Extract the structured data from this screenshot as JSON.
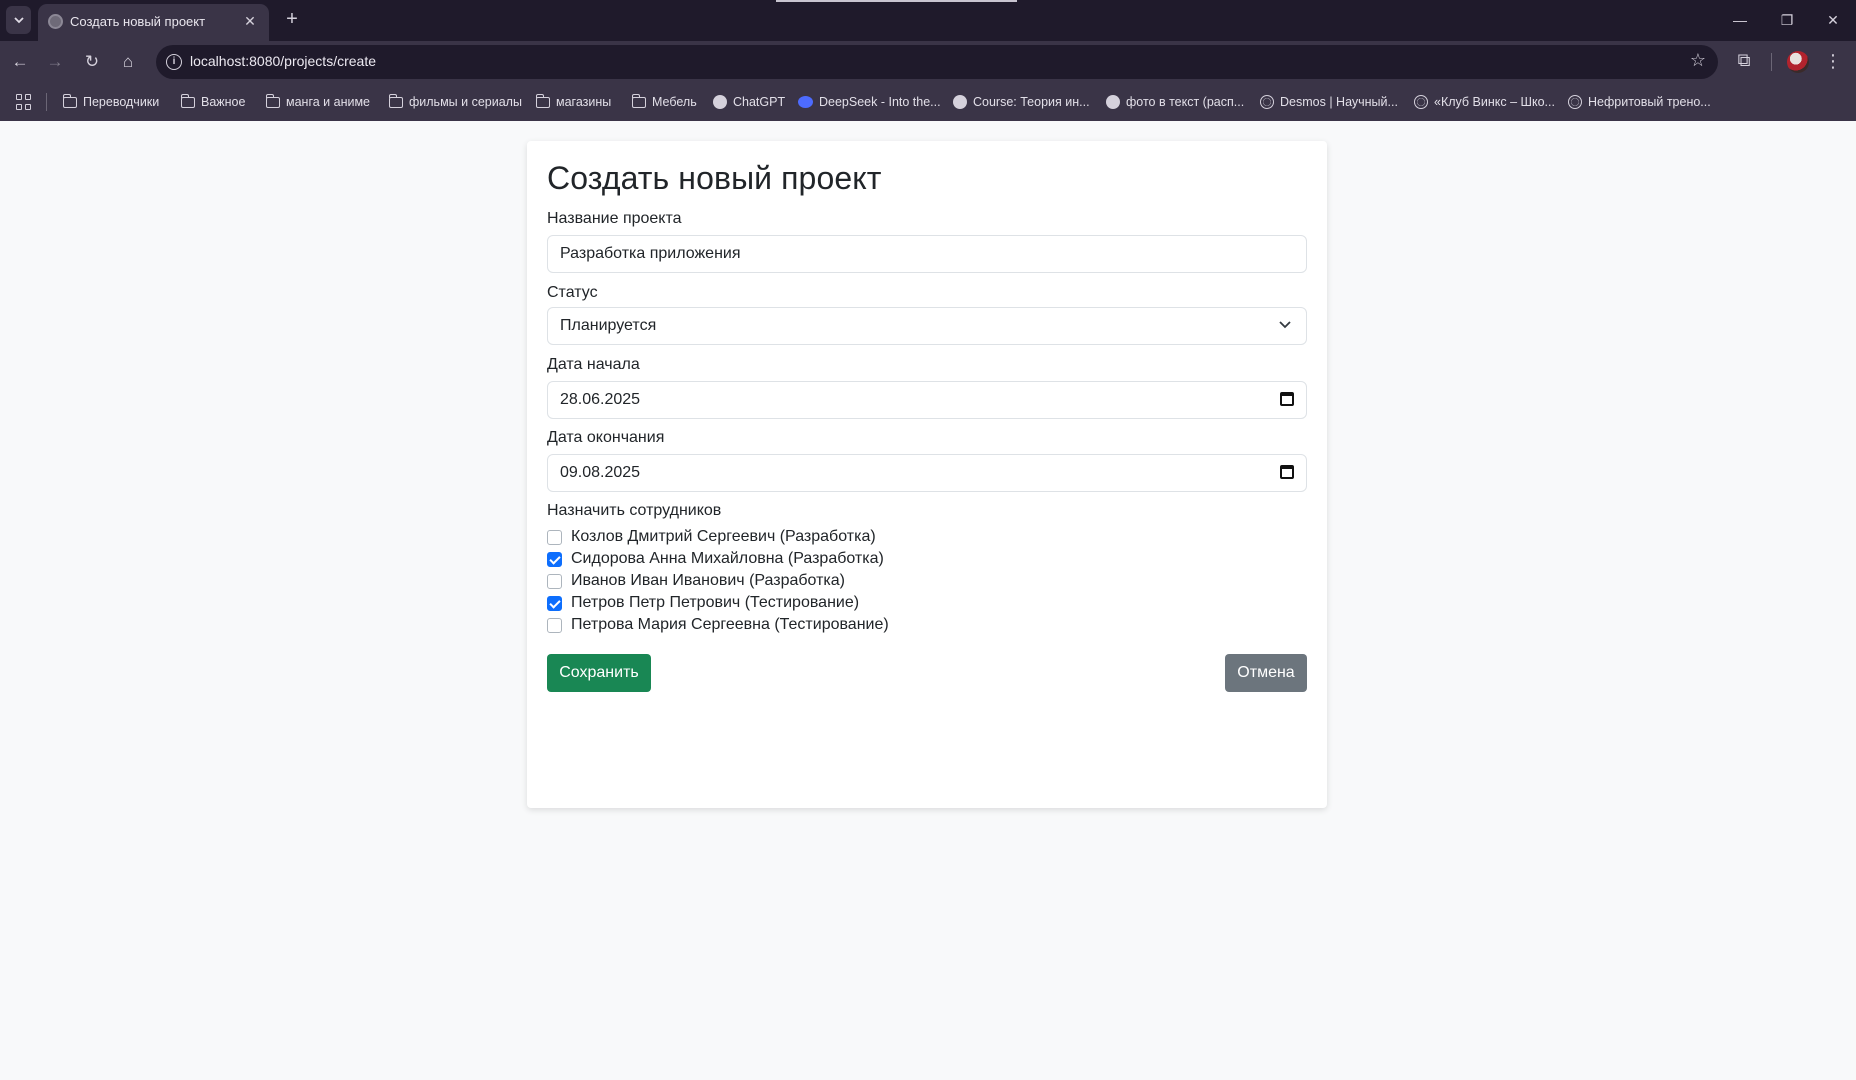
{
  "browser": {
    "tab_title": "Создать новый проект",
    "url": "localhost:8080/projects/create",
    "bookmarks": [
      {
        "label": "Переводчики",
        "icon": "folder-icon"
      },
      {
        "label": "Важное",
        "icon": "folder-icon"
      },
      {
        "label": "манга и аниме",
        "icon": "folder-icon"
      },
      {
        "label": "фильмы и сериалы",
        "icon": "folder-icon"
      },
      {
        "label": "магазины",
        "icon": "folder-icon"
      },
      {
        "label": "Мебель",
        "icon": "folder-icon"
      },
      {
        "label": "ChatGPT",
        "icon": "chatgpt-icon"
      },
      {
        "label": "DeepSeek - Into the...",
        "icon": "deepseek-icon"
      },
      {
        "label": "Course: Теория ин...",
        "icon": "course-icon"
      },
      {
        "label": "фото в текст (расп...",
        "icon": "ocr-icon"
      },
      {
        "label": "Desmos | Научный...",
        "icon": "globe-icon"
      },
      {
        "label": "«Клуб Винкс – Шко...",
        "icon": "globe-icon"
      },
      {
        "label": "Нефритовый трено...",
        "icon": "globe-icon"
      }
    ]
  },
  "form": {
    "title": "Создать новый проект",
    "name_label": "Название проекта",
    "name_value": "Разработка приложения",
    "status_label": "Статус",
    "status_value": "Планируется",
    "start_label": "Дата начала",
    "start_value": "28.06.2025",
    "end_label": "Дата окончания",
    "end_value": "09.08.2025",
    "employees_label": "Назначить сотрудников",
    "employees": [
      {
        "label": "Козлов Дмитрий Сергеевич (Разработка)",
        "checked": false
      },
      {
        "label": "Сидорова Анна Михайловна (Разработка)",
        "checked": true
      },
      {
        "label": "Иванов Иван Иванович (Разработка)",
        "checked": false
      },
      {
        "label": "Петров Петр Петрович (Тестирование)",
        "checked": true
      },
      {
        "label": "Петрова Мария Сергеевна (Тестирование)",
        "checked": false
      }
    ],
    "save_label": "Сохранить",
    "cancel_label": "Отмена"
  },
  "colors": {
    "save": "#198754",
    "cancel": "#6c757d",
    "checkbox_checked": "#0d6efd"
  }
}
